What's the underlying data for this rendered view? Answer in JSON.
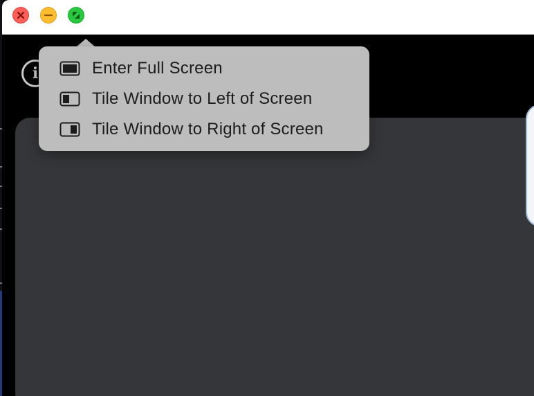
{
  "window": {
    "buttons": {
      "close": "close-icon",
      "minimize": "minimize-icon",
      "zoom": "fullscreen-icon"
    },
    "info_icon": "i"
  },
  "menu": {
    "items": [
      {
        "label": "Enter Full Screen",
        "icon": "full-screen-icon"
      },
      {
        "label": "Tile Window to Left of Screen",
        "icon": "tile-left-icon"
      },
      {
        "label": "Tile Window to Right of Screen",
        "icon": "tile-right-icon"
      }
    ]
  },
  "colors": {
    "close": "#ff5f57",
    "minimize": "#febc2e",
    "zoom": "#28c840",
    "menu_bg": "#bdbdbd",
    "panel_bg": "#353639"
  }
}
